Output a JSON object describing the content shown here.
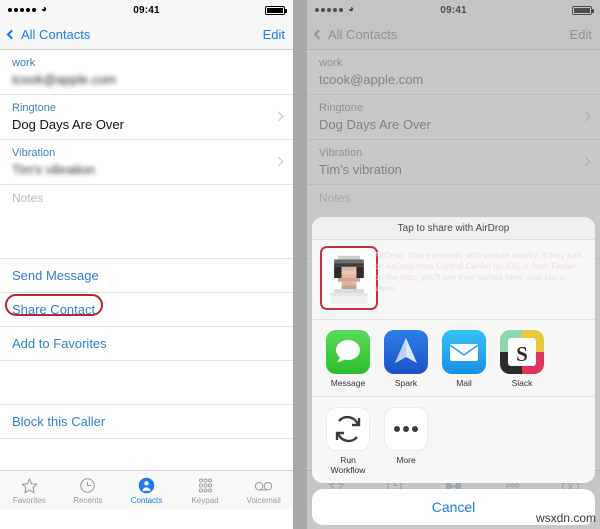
{
  "watermark": "wsxdn.com",
  "statusbar": {
    "time": "09:41",
    "signal_dots": 5,
    "wifi_icon": "wifi-icon",
    "battery_icon": "battery-full-icon"
  },
  "left_phone": {
    "navbar": {
      "back_label": "All Contacts",
      "back_icon": "chevron-left-icon",
      "edit_label": "Edit"
    },
    "fields": [
      {
        "label": "work",
        "value": "tcook@apple.com",
        "blurred": true,
        "chevron": false
      },
      {
        "label": "Ringtone",
        "value": "Dog Days Are Over",
        "blurred": false,
        "chevron": true
      },
      {
        "label": "Vibration",
        "value": "Tim's vibration",
        "blurred": true,
        "chevron": true
      }
    ],
    "notes_placeholder": "Notes",
    "actions": [
      {
        "label": "Send Message",
        "highlighted": false
      },
      {
        "label": "Share Contact",
        "highlighted": true
      },
      {
        "label": "Add to Favorites",
        "highlighted": false
      },
      {
        "label": "Block this Caller",
        "highlighted": false
      }
    ],
    "annotation_color": "#b02a37"
  },
  "right_phone": {
    "navbar": {
      "back_label": "All Contacts",
      "back_icon": "chevron-left-icon",
      "edit_label": "Edit"
    },
    "fields": [
      {
        "label": "work",
        "value": "tcook@apple.com",
        "chevron": false
      },
      {
        "label": "Ringtone",
        "value": "Dog Days Are Over",
        "chevron": true
      },
      {
        "label": "Vibration",
        "value": "Tim's vibration",
        "chevron": true
      }
    ],
    "share_sheet": {
      "title": "Tap to share with AirDrop",
      "airdrop_blurb": "AirDrop. Share instantly with people nearby. If they turn on AirDrop from Control Center on iOS or from Finder on the Mac, you'll see their names here. Just tap to share.",
      "airdrop_contact_avatar": "pixelated-avatar-icon",
      "apps": [
        {
          "label": "Message",
          "icon": "messages-app-icon"
        },
        {
          "label": "Spark",
          "icon": "spark-app-icon"
        },
        {
          "label": "Mail",
          "icon": "mail-app-icon"
        },
        {
          "label": "Slack",
          "icon": "slack-app-icon"
        }
      ],
      "actions": [
        {
          "label": "Run Workflow",
          "icon": "workflow-refresh-icon"
        },
        {
          "label": "More",
          "icon": "ellipsis-icon"
        }
      ],
      "cancel_label": "Cancel"
    },
    "annotation_color": "#c0343f"
  },
  "tabbar": {
    "items": [
      {
        "label": "Favorites",
        "icon": "star-icon",
        "active": false
      },
      {
        "label": "Recents",
        "icon": "clock-icon",
        "active": false
      },
      {
        "label": "Contacts",
        "icon": "contact-person-icon",
        "active": true
      },
      {
        "label": "Keypad",
        "icon": "keypad-dots-icon",
        "active": false
      },
      {
        "label": "Voicemail",
        "icon": "voicemail-icon",
        "active": false
      }
    ]
  }
}
